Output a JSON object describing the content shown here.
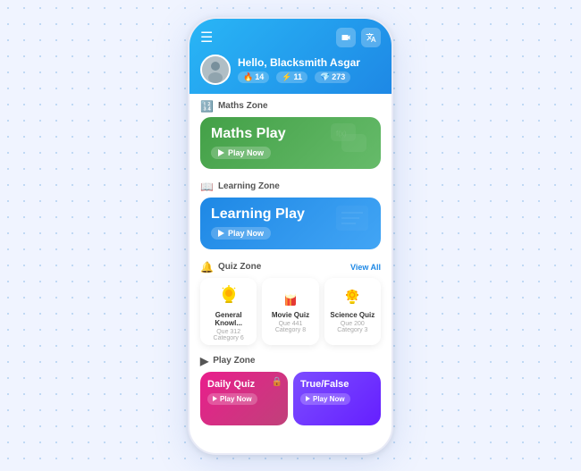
{
  "header": {
    "greeting": "Hello, Blacksmith Asgar",
    "hamburger_label": "☰",
    "icon1": "📷",
    "icon2": "🔤",
    "stats": [
      {
        "icon": "🔥",
        "value": "14"
      },
      {
        "icon": "⚡",
        "value": "11"
      },
      {
        "icon": "💎",
        "value": "273"
      }
    ]
  },
  "maths_zone": {
    "section_label": "Maths Zone",
    "section_icon": "123",
    "card_title": "Maths Play",
    "play_label": "Play Now"
  },
  "learning_zone": {
    "section_label": "Learning Zone",
    "card_title": "Learning Play",
    "play_label": "Play Now"
  },
  "quiz_zone": {
    "section_label": "Quiz Zone",
    "view_all_label": "View All",
    "cards": [
      {
        "title": "General Knowl...",
        "sub": "Que 312  Category 6"
      },
      {
        "title": "Movie Quiz",
        "sub": "Que 441  Category 8"
      },
      {
        "title": "Science Quiz",
        "sub": "Que 200  Category 3"
      }
    ]
  },
  "play_zone": {
    "section_label": "Play Zone",
    "daily_quiz": {
      "title": "Daily Quiz",
      "play_label": "Play Now"
    },
    "true_false": {
      "title": "True/False",
      "play_label": "Play Now"
    }
  }
}
